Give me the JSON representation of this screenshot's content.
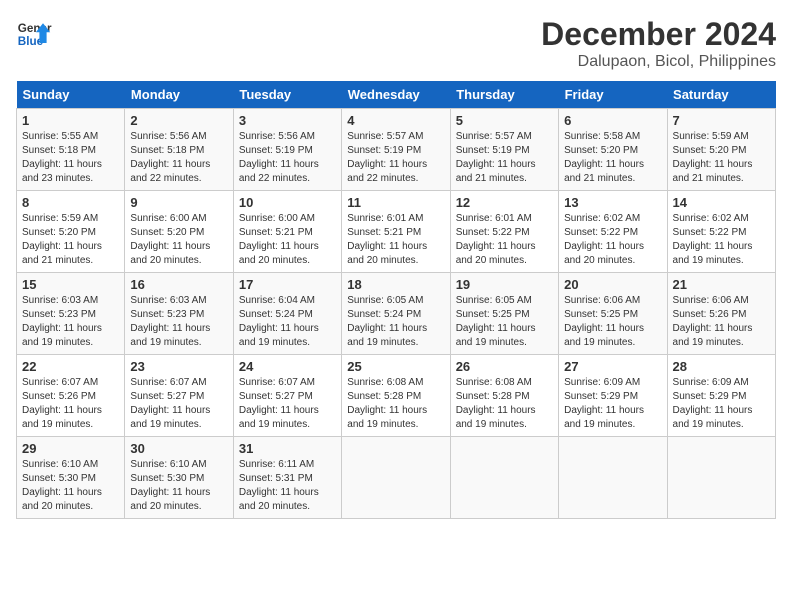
{
  "logo": {
    "line1": "General",
    "line2": "Blue"
  },
  "title": "December 2024",
  "subtitle": "Dalupaon, Bicol, Philippines",
  "days_of_week": [
    "Sunday",
    "Monday",
    "Tuesday",
    "Wednesday",
    "Thursday",
    "Friday",
    "Saturday"
  ],
  "weeks": [
    [
      {
        "day": "1",
        "sunrise": "5:55 AM",
        "sunset": "5:18 PM",
        "daylight": "11 hours and 23 minutes."
      },
      {
        "day": "2",
        "sunrise": "5:56 AM",
        "sunset": "5:18 PM",
        "daylight": "11 hours and 22 minutes."
      },
      {
        "day": "3",
        "sunrise": "5:56 AM",
        "sunset": "5:19 PM",
        "daylight": "11 hours and 22 minutes."
      },
      {
        "day": "4",
        "sunrise": "5:57 AM",
        "sunset": "5:19 PM",
        "daylight": "11 hours and 22 minutes."
      },
      {
        "day": "5",
        "sunrise": "5:57 AM",
        "sunset": "5:19 PM",
        "daylight": "11 hours and 21 minutes."
      },
      {
        "day": "6",
        "sunrise": "5:58 AM",
        "sunset": "5:20 PM",
        "daylight": "11 hours and 21 minutes."
      },
      {
        "day": "7",
        "sunrise": "5:59 AM",
        "sunset": "5:20 PM",
        "daylight": "11 hours and 21 minutes."
      }
    ],
    [
      {
        "day": "8",
        "sunrise": "5:59 AM",
        "sunset": "5:20 PM",
        "daylight": "11 hours and 21 minutes."
      },
      {
        "day": "9",
        "sunrise": "6:00 AM",
        "sunset": "5:20 PM",
        "daylight": "11 hours and 20 minutes."
      },
      {
        "day": "10",
        "sunrise": "6:00 AM",
        "sunset": "5:21 PM",
        "daylight": "11 hours and 20 minutes."
      },
      {
        "day": "11",
        "sunrise": "6:01 AM",
        "sunset": "5:21 PM",
        "daylight": "11 hours and 20 minutes."
      },
      {
        "day": "12",
        "sunrise": "6:01 AM",
        "sunset": "5:22 PM",
        "daylight": "11 hours and 20 minutes."
      },
      {
        "day": "13",
        "sunrise": "6:02 AM",
        "sunset": "5:22 PM",
        "daylight": "11 hours and 20 minutes."
      },
      {
        "day": "14",
        "sunrise": "6:02 AM",
        "sunset": "5:22 PM",
        "daylight": "11 hours and 19 minutes."
      }
    ],
    [
      {
        "day": "15",
        "sunrise": "6:03 AM",
        "sunset": "5:23 PM",
        "daylight": "11 hours and 19 minutes."
      },
      {
        "day": "16",
        "sunrise": "6:03 AM",
        "sunset": "5:23 PM",
        "daylight": "11 hours and 19 minutes."
      },
      {
        "day": "17",
        "sunrise": "6:04 AM",
        "sunset": "5:24 PM",
        "daylight": "11 hours and 19 minutes."
      },
      {
        "day": "18",
        "sunrise": "6:05 AM",
        "sunset": "5:24 PM",
        "daylight": "11 hours and 19 minutes."
      },
      {
        "day": "19",
        "sunrise": "6:05 AM",
        "sunset": "5:25 PM",
        "daylight": "11 hours and 19 minutes."
      },
      {
        "day": "20",
        "sunrise": "6:06 AM",
        "sunset": "5:25 PM",
        "daylight": "11 hours and 19 minutes."
      },
      {
        "day": "21",
        "sunrise": "6:06 AM",
        "sunset": "5:26 PM",
        "daylight": "11 hours and 19 minutes."
      }
    ],
    [
      {
        "day": "22",
        "sunrise": "6:07 AM",
        "sunset": "5:26 PM",
        "daylight": "11 hours and 19 minutes."
      },
      {
        "day": "23",
        "sunrise": "6:07 AM",
        "sunset": "5:27 PM",
        "daylight": "11 hours and 19 minutes."
      },
      {
        "day": "24",
        "sunrise": "6:07 AM",
        "sunset": "5:27 PM",
        "daylight": "11 hours and 19 minutes."
      },
      {
        "day": "25",
        "sunrise": "6:08 AM",
        "sunset": "5:28 PM",
        "daylight": "11 hours and 19 minutes."
      },
      {
        "day": "26",
        "sunrise": "6:08 AM",
        "sunset": "5:28 PM",
        "daylight": "11 hours and 19 minutes."
      },
      {
        "day": "27",
        "sunrise": "6:09 AM",
        "sunset": "5:29 PM",
        "daylight": "11 hours and 19 minutes."
      },
      {
        "day": "28",
        "sunrise": "6:09 AM",
        "sunset": "5:29 PM",
        "daylight": "11 hours and 19 minutes."
      }
    ],
    [
      {
        "day": "29",
        "sunrise": "6:10 AM",
        "sunset": "5:30 PM",
        "daylight": "11 hours and 20 minutes."
      },
      {
        "day": "30",
        "sunrise": "6:10 AM",
        "sunset": "5:30 PM",
        "daylight": "11 hours and 20 minutes."
      },
      {
        "day": "31",
        "sunrise": "6:11 AM",
        "sunset": "5:31 PM",
        "daylight": "11 hours and 20 minutes."
      },
      null,
      null,
      null,
      null
    ]
  ]
}
